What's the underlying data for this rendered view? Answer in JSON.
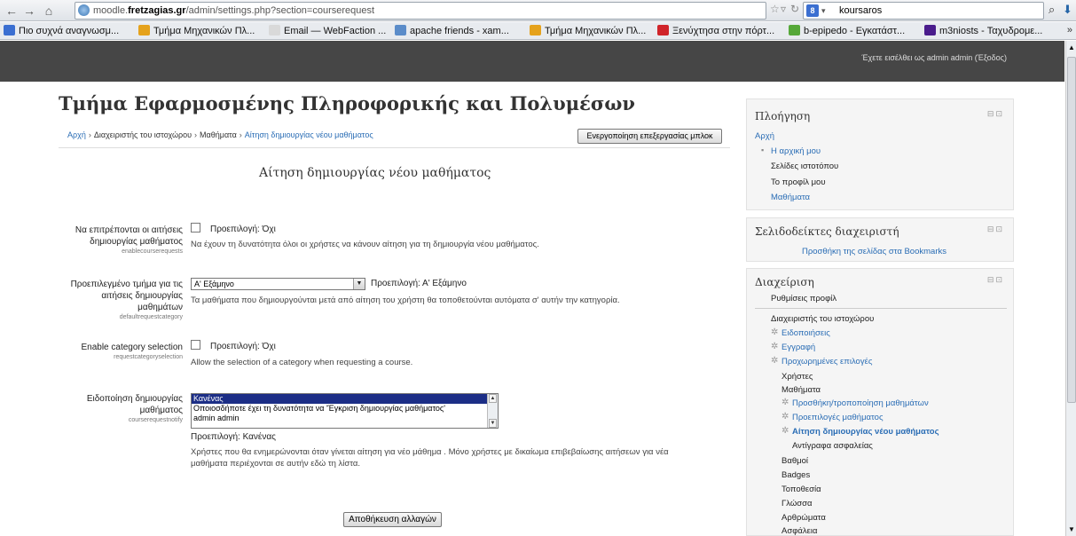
{
  "browser": {
    "url_prefix": "moodle.",
    "url_host": "fretzagias.gr",
    "url_path": "/admin/settings.php?section=courserequest",
    "search_engine_icon": "8",
    "search_query": "koursaros",
    "bookmarks": [
      {
        "label": "Πιο συχνά αναγνωσμ...",
        "icon": "bookmark-icon",
        "color": "#3b6fd1"
      },
      {
        "label": "Τμήμα Μηχανικών Πλ...",
        "icon": "teiep-icon",
        "color": "#e5a21c"
      },
      {
        "label": "Email — WebFaction ...",
        "icon": "webfaction-icon",
        "color": "#d9d9d9"
      },
      {
        "label": "apache friends - xam...",
        "icon": "xampp-icon",
        "color": "#5b8cc9"
      },
      {
        "label": "Τμήμα Μηχανικών Πλ...",
        "icon": "teiep-icon",
        "color": "#e5a21c"
      },
      {
        "label": "Ξενύχτησα στην πόρτ...",
        "icon": "youtube-icon",
        "color": "#d0242a"
      },
      {
        "label": "b-epipedo - Εγκατάστ...",
        "icon": "pinwheel-icon",
        "color": "#56a839"
      },
      {
        "label": "m3niosts - Ταχυδρομε...",
        "icon": "yahoo-icon",
        "color": "#4a1c8c"
      }
    ],
    "more": "»"
  },
  "header": {
    "login_info": "Έχετε εισέλθει ως admin admin (Έξοδος)",
    "site_title": "Τμήμα Εφαρμοσμένης Πληροφορικής και Πολυμέσων"
  },
  "breadcrumb": {
    "items": [
      "Αρχή",
      "Διαχειριστής του ιστοχώρου",
      "Μαθήματα"
    ],
    "current": "Αίτηση δημιουργίας νέου μαθήματος",
    "separator": "›"
  },
  "block_edit_button": "Ενεργοποίηση επεξεργασίας μπλοκ",
  "page_heading": "Αίτηση δημιουργίας νέου μαθήματος",
  "settings": {
    "enable": {
      "label_line1": "Να επιτρέπονται οι αιτήσεις",
      "label_line2": "δημιουργίας μαθήματος",
      "key": "enablecourserequests",
      "default": "Προεπιλογή: Όχι",
      "description": "Να έχουν τη δυνατότητα όλοι οι χρήστες να κάνουν αίτηση για τη δημιουργία νέου μαθήματος."
    },
    "default_category": {
      "label_line1": "Προεπιλεγμένο τμήμα για τις",
      "label_line2": "αιτήσεις δημιουργίας",
      "label_line3": "μαθημάτων",
      "key": "defaultrequestcategory",
      "selected": "Α' Εξάμηνο",
      "default": "Προεπιλογή: Α' Εξάμηνο",
      "description": "Τα μαθήματα που δημιουργούνται μετά από αίτηση του χρήστη θα τοποθετούνται αυτόματα σ' αυτήν την κατηγορία."
    },
    "category_selection": {
      "label_line1": "Enable category selection",
      "key": "requestcategoryselection",
      "default": "Προεπιλογή: Όχι",
      "description": "Allow the selection of a category when requesting a course."
    },
    "notify": {
      "label_line1": "Ειδοποίηση δημιουργίας",
      "label_line2": "μαθήματος",
      "key": "courserequestnotify",
      "options": [
        "Κανένας",
        "Οποιοσδήποτε έχει τη δυνατότητα να 'Έγκριση δημιουργίας μαθήματος'",
        "admin admin"
      ],
      "default": "Προεπιλογή: Κανένας",
      "description_line1": "Χρήστες που θα ενημερώνονται όταν γίνεται αίτηση για νέο μάθημα . Μόνο χρήστες με δικαίωμα επιβεβαίωσης αιτήσεων για νέα",
      "description_line2": "μαθήματα περιέχονται σε αυτήν εδώ τη λίστα."
    }
  },
  "save_button": "Αποθήκευση αλλαγών",
  "blocks": {
    "navigation": {
      "title": "Πλοήγηση",
      "home": "Αρχή",
      "my_home": "Η αρχική μου",
      "site_pages": "Σελίδες ιστοτόπου",
      "my_profile": "Το προφίλ μου",
      "courses": "Μαθήματα"
    },
    "bookmarks": {
      "title": "Σελιδοδείκτες διαχειριστή",
      "link": "Προσθήκη της σελίδας στα Bookmarks"
    },
    "admin": {
      "title": "Διαχείριση",
      "profile_settings": "Ρυθμίσεις προφίλ",
      "site_admin": "Διαχειριστής του ιστοχώρου",
      "notifications": "Ειδοποιήσεις",
      "registration": "Εγγραφή",
      "advanced": "Προχωρημένες επιλογές",
      "users": "Χρήστες",
      "courses": "Μαθήματα",
      "add_edit_courses": "Προσθήκη/τροποποίηση μαθημάτων",
      "course_defaults": "Προεπιλογές μαθήματος",
      "course_request": "Αίτηση δημιουργίας νέου μαθήματος",
      "backups": "Αντίγραφα ασφαλείας",
      "grades": "Βαθμοί",
      "badges": "Badges",
      "location": "Τοποθεσία",
      "language": "Γλώσσα",
      "plugins": "Αρθρώματα",
      "security": "Ασφάλεια"
    }
  }
}
